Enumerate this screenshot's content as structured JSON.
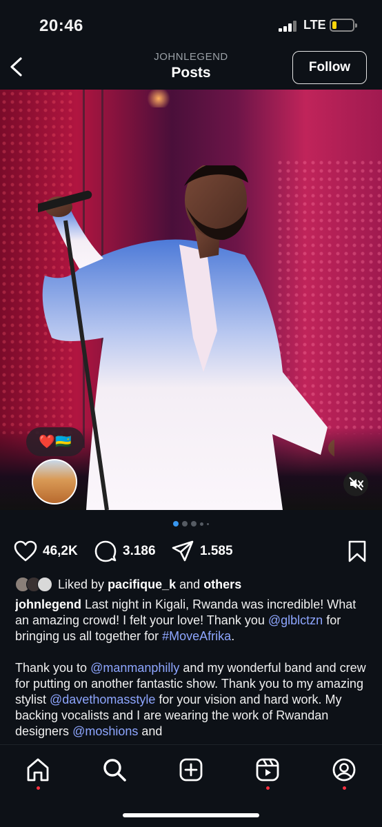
{
  "status_bar": {
    "time": "20:46",
    "network": "LTE",
    "battery_level": 0.15,
    "battery_color": "#ffd60a"
  },
  "header": {
    "account": "JOHNLEGEND",
    "title": "Posts",
    "follow_label": "Follow",
    "back_icon": "chevron-left-icon"
  },
  "post": {
    "carousel": {
      "count": 4,
      "active": 0
    },
    "story_reaction": "❤️🇷🇼",
    "actions": {
      "likes": "46,2K",
      "comments": "3.186",
      "shares": "1.585"
    },
    "liked_by": {
      "prefix": "Liked by",
      "user": "pacifique_k",
      "connector": "and",
      "others": "others"
    },
    "caption": {
      "username": "johnlegend",
      "p1_a": "Last night in Kigali, Rwanda was incredible! What an amazing crowd!  I felt your love!  Thank you",
      "p1_link1": "@glblctzn",
      "p1_b": "for bringing us all together for",
      "p1_link2": "#MoveAfrika",
      "p1_c": ".",
      "p2_a": "Thank you to",
      "p2_link1": "@manmanphilly",
      "p2_b": "and my wonderful band and crew for putting on another fantastic show.  Thank you to my amazing stylist",
      "p2_link2": "@davethomasstyle",
      "p2_c": "for your vision and hard work. My backing vocalists and I are wearing the work of Rwandan designers",
      "p2_link3": "@moshions",
      "p2_d": "and"
    }
  },
  "nav": {
    "items": [
      "home-icon",
      "search-icon",
      "create-icon",
      "reels-icon",
      "profile-icon"
    ],
    "accent": "#ff3040"
  }
}
